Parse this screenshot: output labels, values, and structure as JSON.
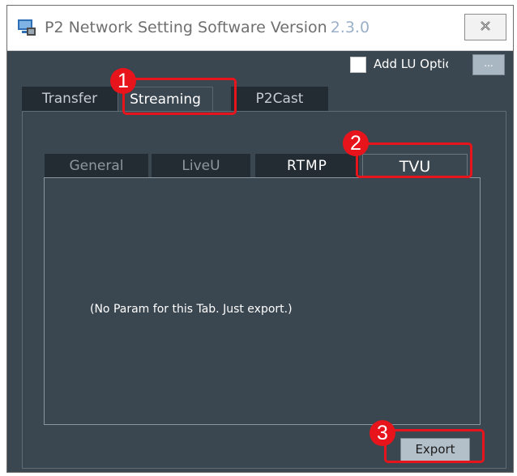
{
  "window": {
    "title": "P2 Network Setting Software  Version",
    "version": "2.3.0",
    "close_icon": "close-icon"
  },
  "option": {
    "label": "Add LU Option",
    "button_label": "..."
  },
  "outer_tabs": [
    {
      "label": "Transfer",
      "active": false
    },
    {
      "label": "Streaming",
      "active": true
    },
    {
      "label": "P2Cast",
      "active": false
    }
  ],
  "inner_tabs": [
    {
      "label": "General",
      "active": false
    },
    {
      "label": "LiveU",
      "active": false
    },
    {
      "label": "RTMP",
      "active": false
    },
    {
      "label": "TVU",
      "active": true
    }
  ],
  "panel": {
    "message": "(No Param for this Tab. Just export.)"
  },
  "export_label": "Export",
  "annotations": [
    {
      "number": "1"
    },
    {
      "number": "2"
    },
    {
      "number": "3"
    }
  ],
  "colors": {
    "window_bg": "#3a4650",
    "tab_inactive_bg": "#232c33",
    "annotation_red": "#e8141b"
  }
}
